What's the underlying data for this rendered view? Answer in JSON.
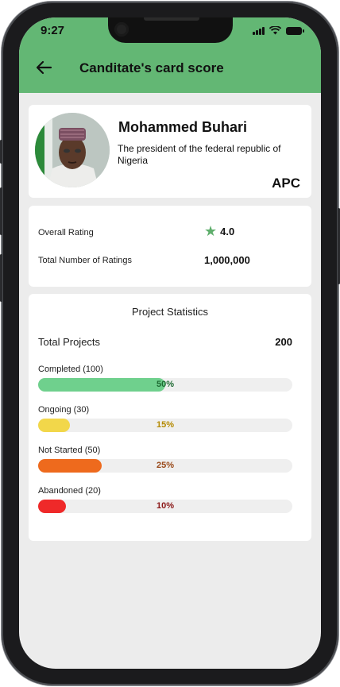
{
  "status_bar": {
    "time": "9:27"
  },
  "header": {
    "title": "Canditate's card score"
  },
  "candidate": {
    "name": "Mohammed Buhari",
    "description": "The president of the federal republic of Nigeria",
    "party": "APC"
  },
  "ratings": {
    "overall_label": "Overall Rating",
    "overall_value": "4.0",
    "total_label": "Total Number of Ratings",
    "total_value": "1,000,000"
  },
  "stats": {
    "title": "Project Statistics",
    "total_label": "Total Projects",
    "total_value": "200",
    "items": [
      {
        "label": "Completed (100)",
        "percent_text": "50%",
        "fraction": 0.5,
        "color": "#6fd08d",
        "text_color": "#1e6b33"
      },
      {
        "label": "Ongoing (30)",
        "percent_text": "15%",
        "fraction": 0.125,
        "color": "#f2d74a",
        "text_color": "#b48a00"
      },
      {
        "label": "Not Started (50)",
        "percent_text": "25%",
        "fraction": 0.25,
        "color": "#ee6a1d",
        "text_color": "#9a4a1a"
      },
      {
        "label": "Abandoned (20)",
        "percent_text": "10%",
        "fraction": 0.11,
        "color": "#ef2929",
        "text_color": "#8a1616"
      }
    ]
  },
  "colors": {
    "header_green": "#63b774",
    "star_green": "#5fae6c",
    "screen_bg": "#ececec"
  }
}
